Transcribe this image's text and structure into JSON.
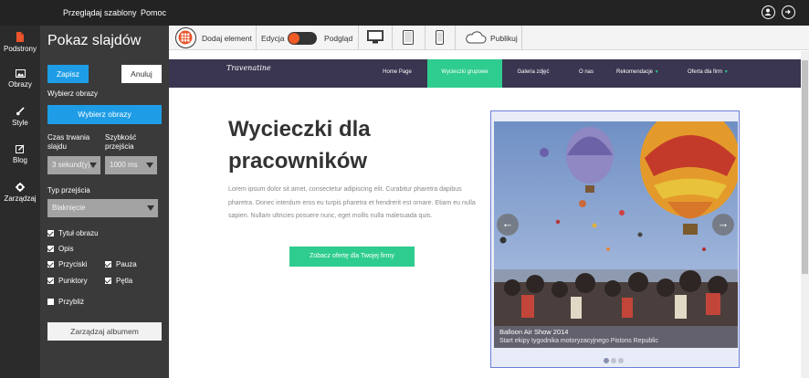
{
  "topbar": {
    "browse_templates": "Przeglądaj szablony",
    "help": "Pomoc",
    "icons": [
      "user-icon",
      "logout-icon"
    ]
  },
  "rail": {
    "items": [
      {
        "label": "Podstrony",
        "icon": "pages-icon"
      },
      {
        "label": "Obrazy",
        "icon": "image-icon"
      },
      {
        "label": "Style",
        "icon": "brush-icon"
      },
      {
        "label": "Blog",
        "icon": "edit-icon"
      },
      {
        "label": "Zarządzaj",
        "icon": "gear-icon"
      }
    ]
  },
  "panel": {
    "title": "Pokaz slajdów",
    "save": "Zapisz",
    "cancel": "Anuluj",
    "choose_images_label": "Wybierz obrazy",
    "choose_images_button": "Wybierz obrazy",
    "duration_label_1": "Czas trwania",
    "duration_label_2": "slajdu",
    "speed_label_1": "Szybkość",
    "speed_label_2": "przejścia",
    "duration_value": "3 sekund(y)",
    "speed_value": "1000 ms",
    "transition_label": "Typ przejścia",
    "transition_value": "Blaknięcie",
    "options": [
      {
        "label": "Tytuł obrazu",
        "checked": true
      },
      {
        "label": "Opis",
        "checked": true
      },
      {
        "label": "Przyciski",
        "checked": true
      },
      {
        "label": "Pauza",
        "checked": true
      },
      {
        "label": "Punktory",
        "checked": true
      },
      {
        "label": "Pętla",
        "checked": true
      },
      {
        "label": "Przybliż",
        "checked": false
      }
    ],
    "manage_album": "Zarządzaj albumem"
  },
  "toolbar": {
    "add_element": "Dodaj element",
    "edit": "Edycja",
    "preview": "Podgląd",
    "publish": "Publikuj",
    "devices": [
      "desktop-icon",
      "tablet-icon",
      "phone-icon"
    ]
  },
  "site": {
    "logo": "Travenatine",
    "nav": [
      {
        "label": "Home Page",
        "active": false,
        "dropdown": false
      },
      {
        "label": "Wycieczki grupowe",
        "active": true,
        "dropdown": false
      },
      {
        "label": "Galeria zdjęć",
        "active": false,
        "dropdown": false
      },
      {
        "label": "O nas",
        "active": false,
        "dropdown": false
      },
      {
        "label": "Rekomendacje",
        "active": false,
        "dropdown": true
      },
      {
        "label": "Oferta dla firm",
        "active": false,
        "dropdown": true
      }
    ],
    "hero_title": "Wycieczki dla pracowników",
    "hero_text": "Lorem ipsum dolor sit amet, consectetur adipiscing elit. Curabitur pharetra dapibus pharetra. Donec interdum eros eu turpis pharetra et hendrerit est ornare. Etiam eu nulla sapien. Nullam ultricies posuere nunc, eget mollis nulla malesuada quis.",
    "cta": "Zobacz ofertę dla Twojej firmy",
    "slider": {
      "caption_title": "Balloon Air Show 2014",
      "caption_text": "Start ekipy tygodnika motoryzacyjnego Pistons Republic",
      "dots": 3,
      "active_dot": 0
    }
  },
  "colors": {
    "accent_blue": "#1e9de6",
    "accent_green": "#2ecc8f",
    "nav_bg": "#3a3550",
    "toggle_orange": "#f15a24"
  }
}
